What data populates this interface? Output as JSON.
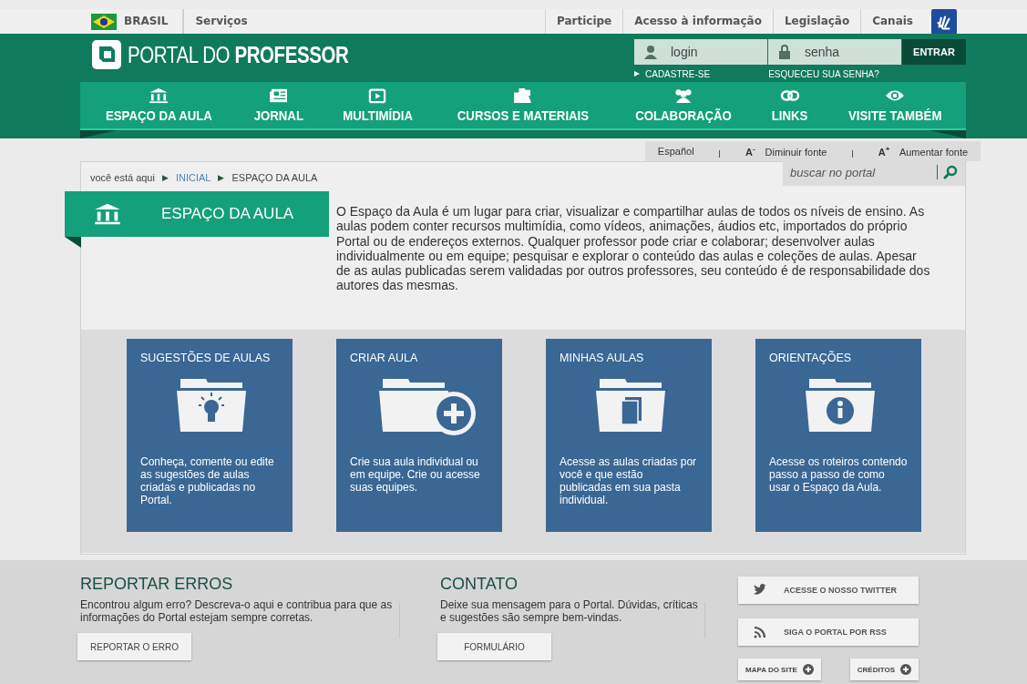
{
  "gov_bar": {
    "country": "BRASIL",
    "left_links": [
      "Serviços"
    ],
    "right_links": [
      "Participe",
      "Acesso à informação",
      "Legislação",
      "Canais"
    ]
  },
  "header": {
    "logo_light": "PORTAL DO ",
    "logo_bold": "PROFESSOR",
    "login": {
      "placeholder": "login"
    },
    "password": {
      "placeholder": "senha"
    },
    "submit": "ENTRAR",
    "register": "CADASTRE-SE",
    "forgot": "ESQUECEU SUA SENHA?"
  },
  "nav": [
    {
      "kind": "building",
      "label": "ESPAÇO DA AULA"
    },
    {
      "kind": "newspaper",
      "label": "JORNAL"
    },
    {
      "kind": "play",
      "label": "MULTIMÍDIA"
    },
    {
      "kind": "folders",
      "label": "CURSOS E MATERIAIS"
    },
    {
      "kind": "people",
      "label": "COLABORAÇÃO"
    },
    {
      "kind": "chain",
      "label": "LINKS"
    },
    {
      "kind": "eye",
      "label": "VISITE TAMBÉM"
    }
  ],
  "tools": {
    "language": "Español",
    "decrease_mark": "A",
    "decrease_sup": "-",
    "decrease": "Diminuir fonte",
    "increase_mark": "A",
    "increase_sup": "+",
    "increase": "Aumentar fonte"
  },
  "breadcrumb": {
    "prefix": "você está aqui",
    "items": [
      "INICIAL",
      "ESPAÇO DA AULA"
    ],
    "separator": "▶"
  },
  "search": {
    "placeholder": "buscar no portal"
  },
  "section": {
    "title": "ESPAÇO DA AULA",
    "description": "O Espaço da Aula é um lugar para criar, visualizar e compartilhar aulas de todos os níveis de ensino. As aulas podem conter recursos multimídia, como vídeos, animações, áudios etc, importados do próprio Portal ou de endereços externos. Qualquer professor pode criar e colaborar; desenvolver aulas individualmente ou em equipe; pesquisar e explorar o conteúdo das aulas e coleções de aulas. Apesar de as aulas publicadas serem validadas por outros professores, seu conteúdo é de responsabilidade dos autores das mesmas."
  },
  "cards": [
    {
      "kind": "bulb",
      "title": "SUGESTÕES DE AULAS",
      "text": "Conheça, comente ou edite as sugestões de aulas criadas e publicadas no Portal."
    },
    {
      "kind": "plus",
      "title": "CRIAR AULA",
      "text": "Crie sua aula individual ou em equipe. Crie ou acesse suas equipes."
    },
    {
      "kind": "pages",
      "title": "MINHAS AULAS",
      "text": "Acesse as aulas criadas por você e que estão publicadas em sua pasta individual."
    },
    {
      "kind": "info",
      "title": "ORIENTAÇÕES",
      "text": "Acesse os roteiros contendo passo a passo de como usar o Espaço da Aula."
    }
  ],
  "footer": {
    "report": {
      "title": "REPORTAR ERROS",
      "text": "Encontrou algum erro? Descreva-o aqui e contribua para que as informações do Portal estejam sempre corretas.",
      "button": "REPORTAR O ERRO"
    },
    "contact": {
      "title": "CONTATO",
      "text": "Deixe sua mensagem para o Portal. Dúvidas, críticas e sugestões são sempre bem-vindas.",
      "button": "FORMULÁRIO"
    },
    "social": [
      {
        "kind": "twitter",
        "label": "ACESSE O NOSSO TWITTER"
      },
      {
        "kind": "rss",
        "label": "SIGA O PORTAL POR RSS"
      }
    ],
    "small_links": [
      "MAPA DO SITE",
      "CRÉDITOS"
    ]
  }
}
